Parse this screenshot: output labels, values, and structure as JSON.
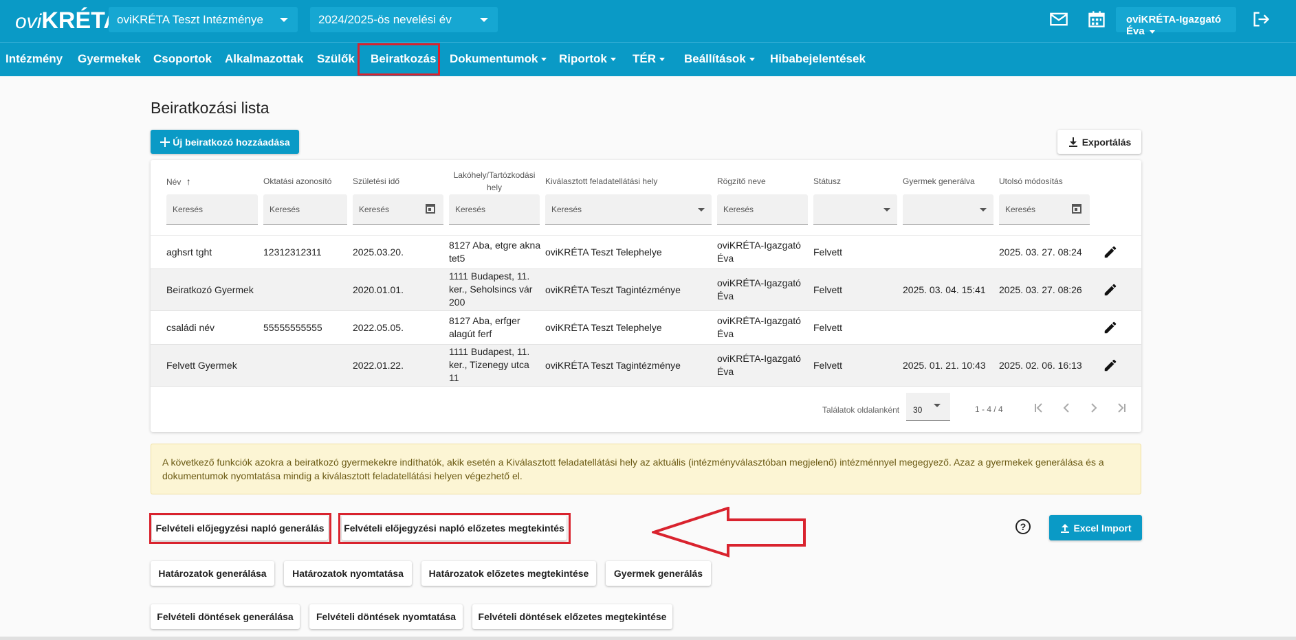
{
  "header": {
    "logo_prefix": "ovi",
    "logo_main": "KRÉTA",
    "institution": "oviKRÉTA Teszt Intézménye",
    "school_year": "2024/2025-ös nevelési év",
    "user": "oviKRÉTA-Igazgató Éva",
    "icons": [
      "mail-icon",
      "calendar-icon",
      "logout-icon"
    ]
  },
  "nav": {
    "items": [
      {
        "label": "Intézmény"
      },
      {
        "label": "Gyermekek"
      },
      {
        "label": "Csoportok"
      },
      {
        "label": "Alkalmazottak"
      },
      {
        "label": "Szülők"
      },
      {
        "label": "Beiratkozás"
      },
      {
        "label": "Dokumentumok"
      },
      {
        "label": "Riportok"
      },
      {
        "label": "TÉR"
      },
      {
        "label": "Beállítások"
      },
      {
        "label": "Hibabejelentések"
      }
    ]
  },
  "page": {
    "title": "Beiratkozási lista",
    "add_button": "Új beiratkozó hozzáadása",
    "export_button": "Exportálás"
  },
  "table": {
    "columns": [
      {
        "label": "Név",
        "sort": "asc"
      },
      {
        "label": "Oktatási azonosító"
      },
      {
        "label": "Születési idő"
      },
      {
        "label": "Lakóhely/Tartózkodási hely"
      },
      {
        "label": "Kiválasztott feladatellátási hely"
      },
      {
        "label": "Rögzítő neve"
      },
      {
        "label": "Státusz"
      },
      {
        "label": "Gyermek generálva"
      },
      {
        "label": "Utolsó módosítás"
      }
    ],
    "filter_placeholder": "Keresés",
    "rows": [
      {
        "name": "aghsrt tght",
        "id": "12312312311",
        "birth": "2025.03.20.",
        "address": "8127 Aba, etgre akna tet5",
        "place": "oviKRÉTA Teszt Telephelye",
        "recorder": "oviKRÉTA-Igazgató Éva",
        "status": "Felvett",
        "generated": "",
        "modified": "2025. 03. 27. 08:24"
      },
      {
        "name": "Beiratkozó Gyermek",
        "id": "",
        "birth": "2020.01.01.",
        "address": "1111 Budapest, 11. ker., Seholsincs vár 200",
        "place": "oviKRÉTA Teszt Tagintézménye",
        "recorder": "oviKRÉTA-Igazgató Éva",
        "status": "Felvett",
        "generated": "2025. 03. 04. 15:41",
        "modified": "2025. 03. 27. 08:26"
      },
      {
        "name": "családi név",
        "id": "55555555555",
        "birth": "2022.05.05.",
        "address": "8127 Aba, erfger alagút ferf",
        "place": "oviKRÉTA Teszt Telephelye",
        "recorder": "oviKRÉTA-Igazgató Éva",
        "status": "Felvett",
        "generated": "",
        "modified": ""
      },
      {
        "name": "Felvett Gyermek",
        "id": "",
        "birth": "2022.01.22.",
        "address": "1111 Budapest, 11. ker., Tizenegy utca 11",
        "place": "oviKRÉTA Teszt Tagintézménye",
        "recorder": "oviKRÉTA-Igazgató Éva",
        "status": "Felvett",
        "generated": "2025. 01. 21. 10:43",
        "modified": "2025. 02. 06. 16:13"
      }
    ],
    "pager": {
      "per_page_label": "Találatok oldalanként",
      "per_page": "30",
      "range": "1 - 4 / 4"
    }
  },
  "info_text": "A következő funkciók azokra a beiratkozó gyermekekre indíthatók, akik esetén a Kiválasztott feladatellátási hely az aktuális (intézményválasztóban megjelenő) intézménnyel megegyező. Azaz a gyermekek generálása és a dokumentumok nyomtatása mindig a kiválasztott feladatellátási helyen végezhető el.",
  "actions": {
    "naplo_gen": "Felvételi előjegyzési napló generálás",
    "naplo_preview": "Felvételi előjegyzési napló előzetes megtekintés",
    "excel_import": "Excel Import",
    "help": "?",
    "hat_gen": "Határozatok generálása",
    "hat_print": "Határozatok nyomtatása",
    "hat_preview": "Határozatok előzetes megtekintése",
    "gyermek_gen": "Gyermek generálás",
    "dont_gen": "Felvételi döntések generálása",
    "dont_print": "Felvételi döntések nyomtatása",
    "dont_preview": "Felvételi döntések előzetes megtekintése"
  },
  "colors": {
    "brand": "#0a9ac6",
    "highlight": "#d9232e",
    "info_bg": "#fcf5d4"
  }
}
